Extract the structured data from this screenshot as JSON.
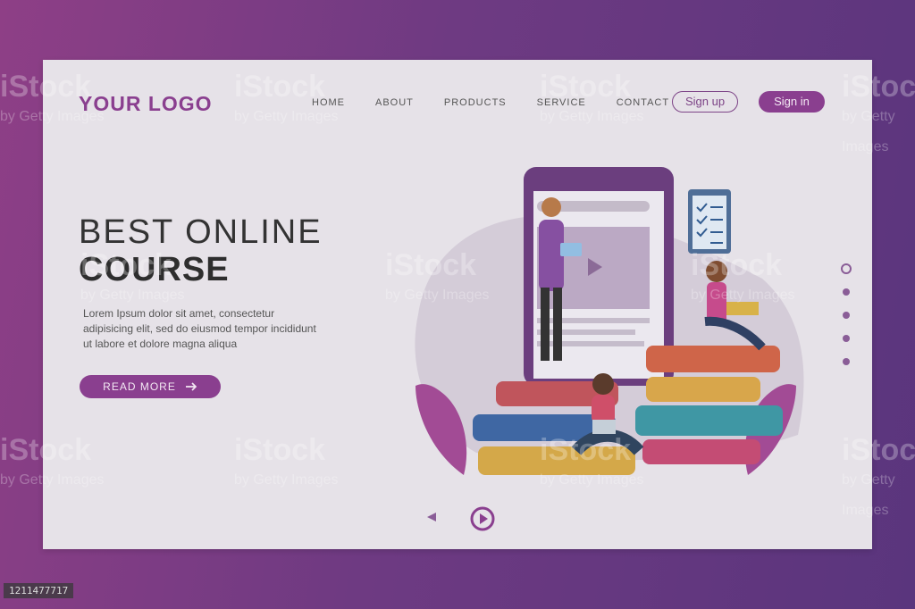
{
  "brand": {
    "logo": "YOUR LOGO"
  },
  "nav": {
    "items": [
      "HOME",
      "ABOUT",
      "PRODUCTS",
      "SERVICE",
      "CONTACT"
    ]
  },
  "auth": {
    "signup": "Sign up",
    "signin": "Sign in"
  },
  "hero": {
    "title_line1": "BEST ONLINE",
    "title_line2": "COURSE",
    "body": "Lorem Ipsum dolor sit amet, consectetur adipisicing elit, sed do eiusmod tempor incididunt ut labore et dolore magna aliqua",
    "cta": "READ MORE",
    "cta_icon": "arrow-right-icon"
  },
  "carousel": {
    "dots": 5,
    "active_index": 0,
    "prev_icon": "triangle-left-icon",
    "next_icon": "play-circle-icon"
  },
  "watermark": {
    "main": "iStock",
    "sub": "by Getty Images"
  },
  "image_id": "1211477717",
  "colors": {
    "accent": "#8a3f8f",
    "background": "#e6e2e8"
  }
}
